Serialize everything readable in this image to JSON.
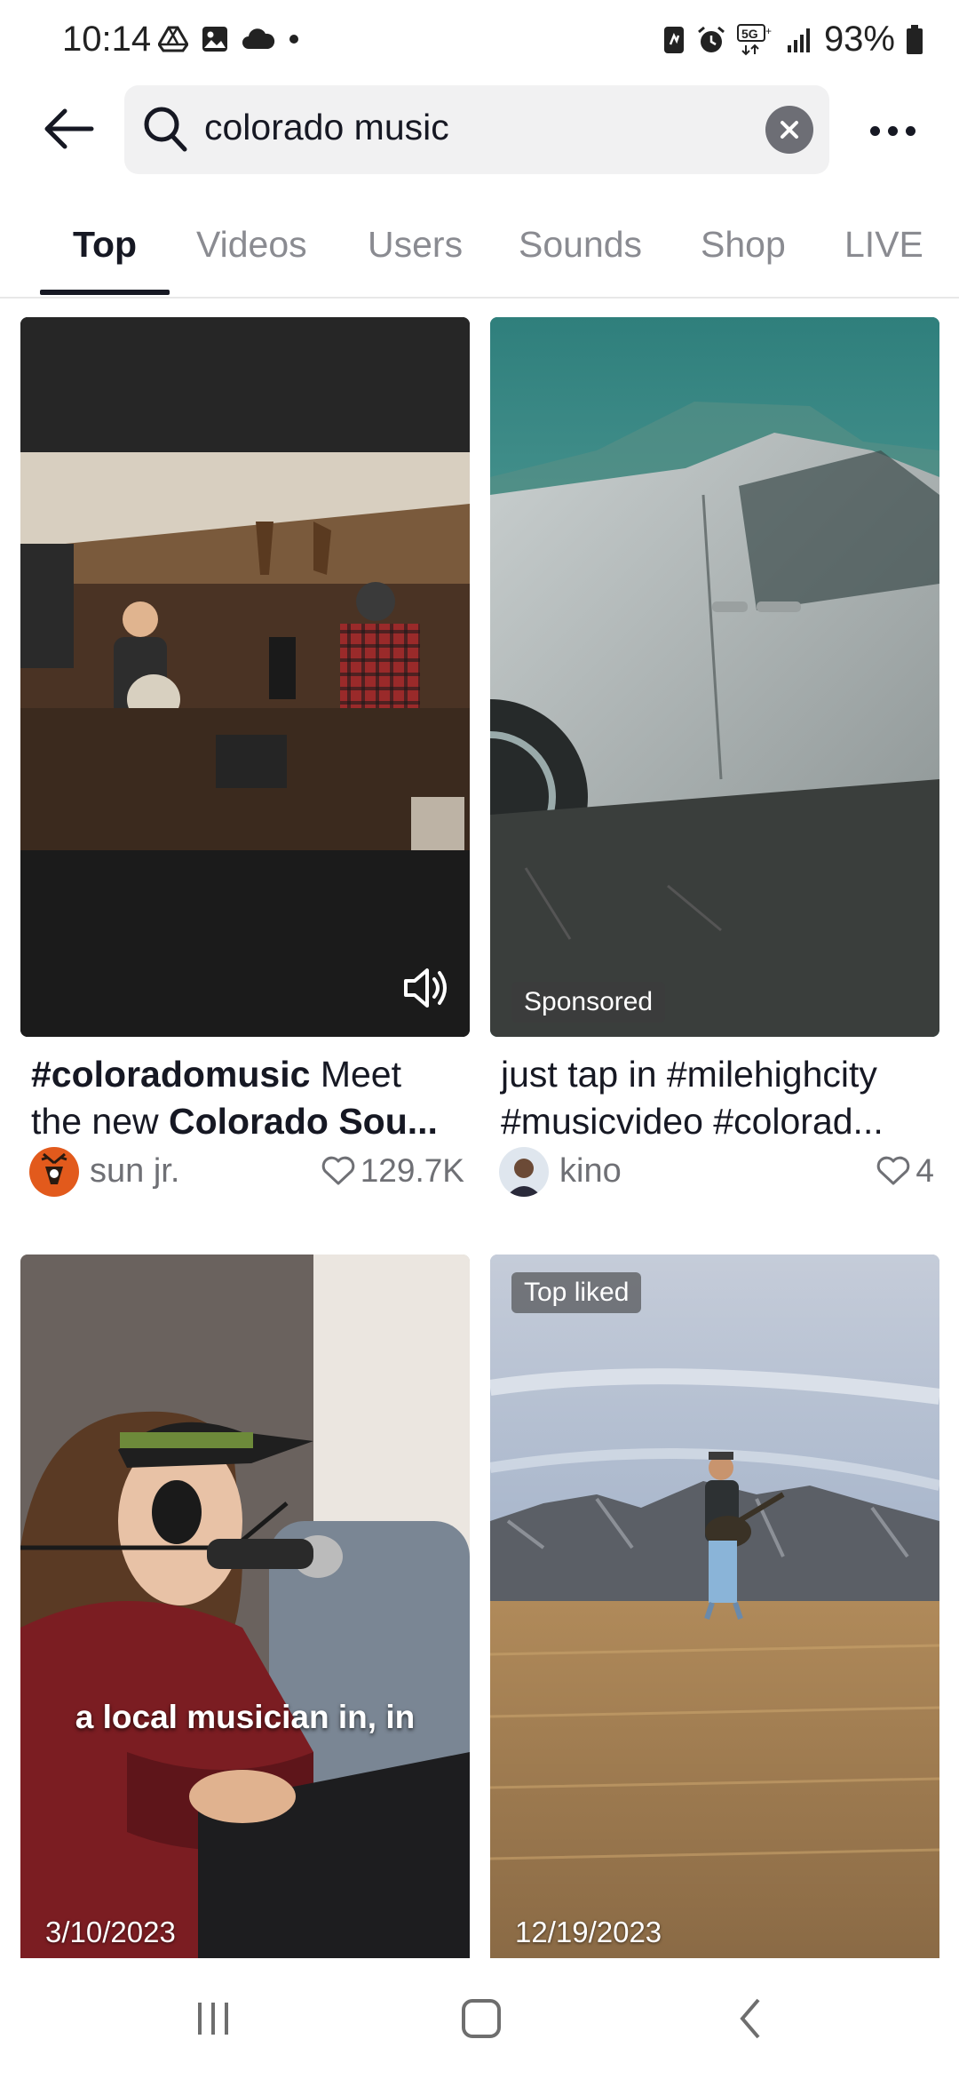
{
  "status_bar": {
    "time": "10:14",
    "battery": "93%",
    "network": "5G"
  },
  "search": {
    "query": "colorado music"
  },
  "tabs": [
    {
      "label": "Top",
      "active": true
    },
    {
      "label": "Videos"
    },
    {
      "label": "Users"
    },
    {
      "label": "Sounds"
    },
    {
      "label": "Shop"
    },
    {
      "label": "LIVE"
    }
  ],
  "results": [
    {
      "caption_tag": "#coloradomusic",
      "caption_text": " Meet the new ",
      "caption_bold": "Colorado Sou...",
      "author": "sun jr.",
      "likes": "129.7K"
    },
    {
      "caption": "just tap in #milehighcity #musicvideo #colorad...",
      "badge": "Sponsored",
      "author": "kino",
      "likes": "4"
    },
    {
      "subtitle": "a local musician in, in",
      "date": "3/10/2023"
    },
    {
      "badge": "Top liked",
      "date": "12/19/2023"
    }
  ]
}
